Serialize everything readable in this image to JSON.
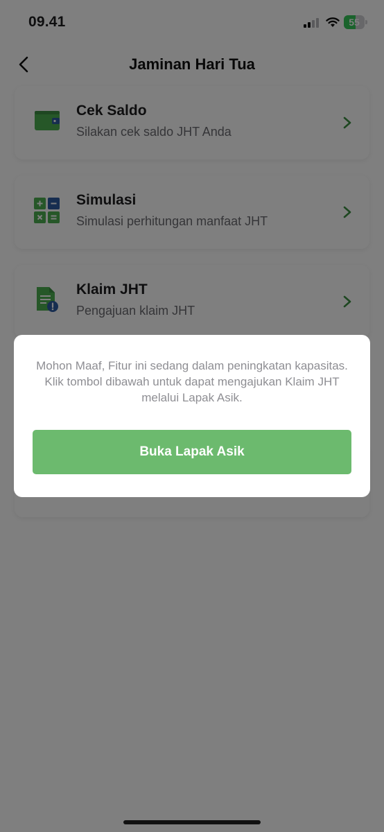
{
  "status_bar": {
    "time": "09.41",
    "battery": "55",
    "battery_level": 0.55
  },
  "header": {
    "title": "Jaminan Hari Tua"
  },
  "cards": [
    {
      "title": "Cek Saldo",
      "subtitle": "Silakan cek saldo JHT Anda",
      "icon": "wallet-icon"
    },
    {
      "title": "Simulasi",
      "subtitle": "Simulasi perhitungan manfaat JHT",
      "icon": "calculator-icon"
    },
    {
      "title": "Klaim JHT",
      "subtitle": "Pengajuan klaim JHT",
      "icon": "claim-document-icon"
    }
  ],
  "dialog": {
    "message": "Mohon Maaf, Fitur ini sedang dalam peningkatan kapasitas. Klik tombol dibawah untuk dapat mengajukan Klaim JHT melalui Lapak Asik.",
    "button_label": "Buka Lapak Asik"
  },
  "colors": {
    "accent_green": "#4caf50",
    "button_green": "#6cba6e",
    "claim_badge_blue": "#2c5aa0"
  }
}
